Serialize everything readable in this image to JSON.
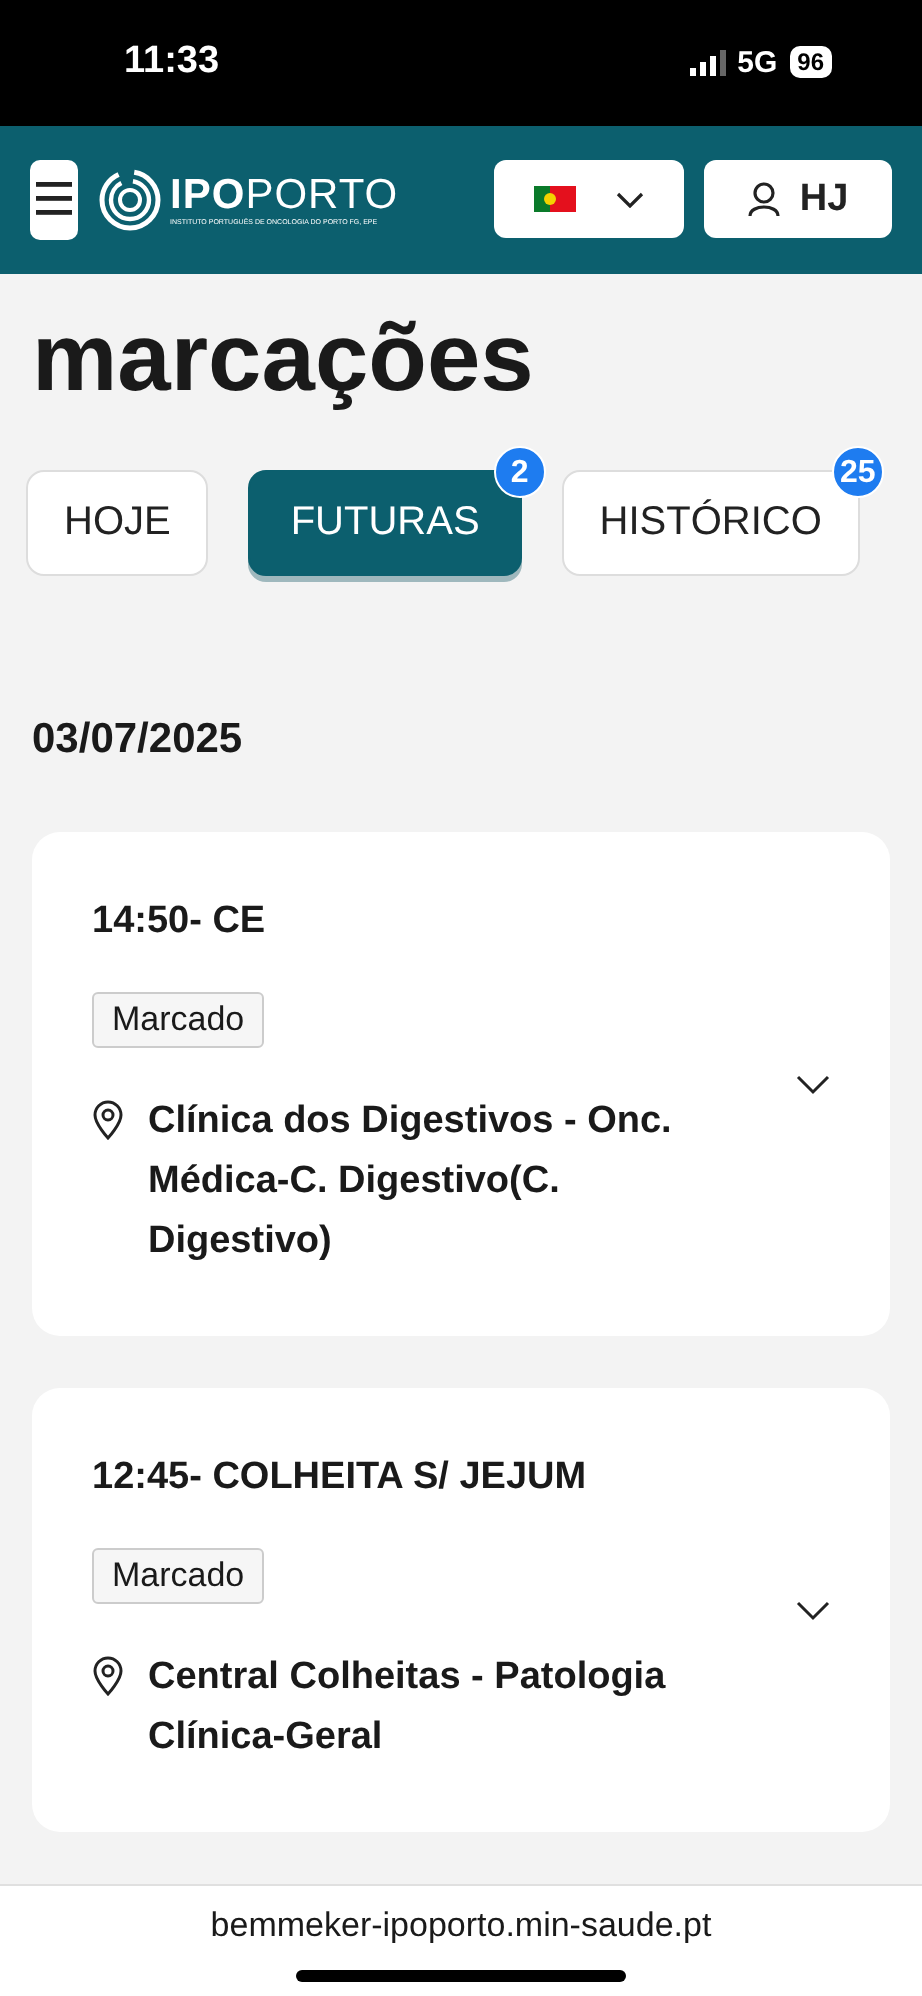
{
  "status_bar": {
    "time": "11:33",
    "network": "5G",
    "battery": "96"
  },
  "header": {
    "logo_strong": "IPO",
    "logo_light": "PORTO",
    "logo_subtitle": "INSTITUTO PORTUGUÊS DE ONCOLOGIA DO PORTO FG, EPE",
    "user_initials": "HJ"
  },
  "page_title": "marcações",
  "tabs": [
    {
      "label": "HOJE",
      "selected": false
    },
    {
      "label": "FUTURAS",
      "selected": true,
      "badge": "2"
    },
    {
      "label": "HISTÓRICO",
      "selected": false,
      "badge": "25"
    }
  ],
  "date": "03/07/2025",
  "appointments": [
    {
      "title": "14:50- CE",
      "status": "Marcado",
      "location": "Clínica dos Digestivos - Onc. Médica-C. Digestivo(C. Digestivo)",
      "expanded": false
    },
    {
      "title": "12:45- COLHEITA S/ JEJUM",
      "status": "Marcado",
      "location": "Central Colheitas - Patologia Clínica-Geral",
      "expanded": false
    }
  ],
  "browser_url": "bemmeker-ipoporto.min-saude.pt"
}
